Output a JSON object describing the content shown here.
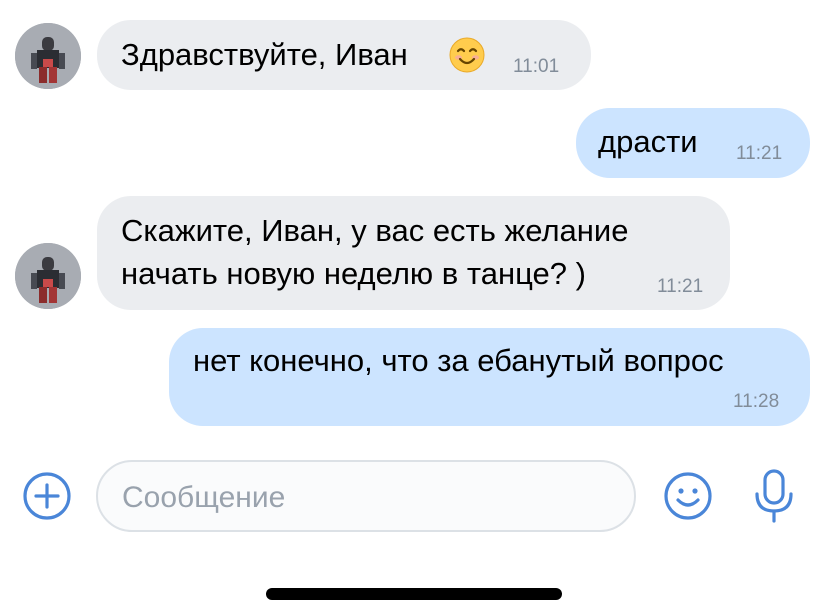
{
  "messages": [
    {
      "direction": "incoming",
      "text_lines": [
        "Здравствуйте, Иван"
      ],
      "emoji": "smiling-face",
      "time": "11:01"
    },
    {
      "direction": "outgoing",
      "text_lines": [
        "драсти"
      ],
      "time": "11:21"
    },
    {
      "direction": "incoming",
      "text_lines": [
        "Скажите, Иван, у вас есть желание",
        "начать новую неделю в танце? )"
      ],
      "time": "11:21"
    },
    {
      "direction": "outgoing",
      "text_lines": [
        "нет конечно, что за ебанутый вопрос"
      ],
      "time": "11:28"
    }
  ],
  "composer": {
    "placeholder": "Сообщение",
    "icons": {
      "add": "plus-circle-icon",
      "emoji": "smile-icon",
      "voice": "microphone-icon"
    }
  },
  "colors": {
    "incoming_bubble": "#ebedf0",
    "outgoing_bubble": "#cce4ff",
    "accent": "#4a86d8",
    "timestamp": "#818c99"
  }
}
